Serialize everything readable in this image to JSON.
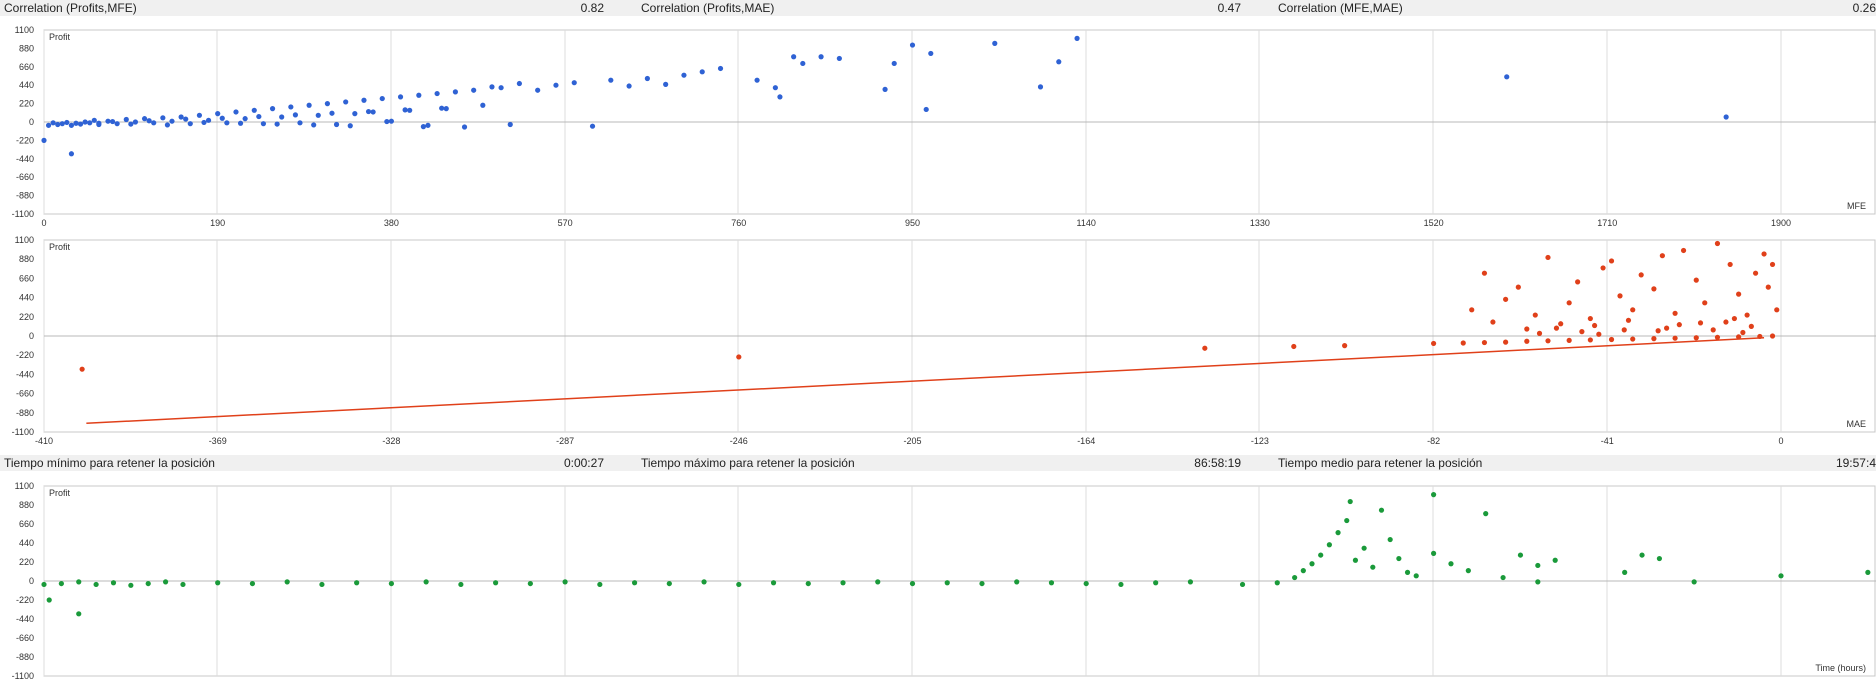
{
  "stats_top": [
    {
      "label": "Correlation (Profits,MFE)",
      "value": "0.82"
    },
    {
      "label": "Correlation (Profits,MAE)",
      "value": "0.47"
    },
    {
      "label": "Correlation (MFE,MAE)",
      "value": "0.26"
    }
  ],
  "stats_time": [
    {
      "label": "Tiempo mínimo para retener la posición",
      "value": "0:00:27"
    },
    {
      "label": "Tiempo máximo para retener la posición",
      "value": "86:58:19"
    },
    {
      "label": "Tiempo medio para retener la posición",
      "value": "19:57:4"
    }
  ],
  "chart_data": [
    {
      "type": "scatter",
      "xlabel": "MFE",
      "ylabel": "Profit",
      "xlim": [
        0,
        1900
      ],
      "ylim": [
        -1100,
        1100
      ],
      "x_ticks": [
        "0",
        "190",
        "380",
        "570",
        "760",
        "950",
        "1140",
        "1330",
        "1520",
        "1710",
        "1900"
      ],
      "y_ticks": [
        "1100",
        "880",
        "660",
        "440",
        "220",
        "0",
        "-220",
        "-440",
        "-660",
        "-880",
        "-1100"
      ],
      "grid": true,
      "color": "#2f62d4",
      "points": [
        [
          0,
          -220
        ],
        [
          30,
          -380
        ],
        [
          5,
          -40
        ],
        [
          10,
          -10
        ],
        [
          15,
          -30
        ],
        [
          20,
          -20
        ],
        [
          25,
          -5
        ],
        [
          30,
          -40
        ],
        [
          35,
          -15
        ],
        [
          40,
          -25
        ],
        [
          45,
          0
        ],
        [
          50,
          -10
        ],
        [
          55,
          20
        ],
        [
          60,
          -30
        ],
        [
          70,
          10
        ],
        [
          80,
          -20
        ],
        [
          90,
          30
        ],
        [
          100,
          0
        ],
        [
          110,
          40
        ],
        [
          120,
          -10
        ],
        [
          130,
          50
        ],
        [
          140,
          10
        ],
        [
          150,
          60
        ],
        [
          160,
          -20
        ],
        [
          170,
          80
        ],
        [
          180,
          20
        ],
        [
          190,
          100
        ],
        [
          200,
          -10
        ],
        [
          210,
          120
        ],
        [
          220,
          40
        ],
        [
          230,
          140
        ],
        [
          240,
          -20
        ],
        [
          250,
          160
        ],
        [
          260,
          60
        ],
        [
          270,
          180
        ],
        [
          280,
          -10
        ],
        [
          290,
          200
        ],
        [
          300,
          80
        ],
        [
          310,
          220
        ],
        [
          320,
          -30
        ],
        [
          330,
          240
        ],
        [
          340,
          100
        ],
        [
          350,
          260
        ],
        [
          360,
          120
        ],
        [
          370,
          280
        ],
        [
          380,
          10
        ],
        [
          390,
          300
        ],
        [
          400,
          140
        ],
        [
          410,
          320
        ],
        [
          420,
          -40
        ],
        [
          430,
          340
        ],
        [
          440,
          160
        ],
        [
          450,
          360
        ],
        [
          460,
          -60
        ],
        [
          470,
          380
        ],
        [
          480,
          200
        ],
        [
          490,
          420
        ],
        [
          500,
          410
        ],
        [
          510,
          -30
        ],
        [
          520,
          460
        ],
        [
          540,
          380
        ],
        [
          560,
          440
        ],
        [
          580,
          470
        ],
        [
          600,
          -50
        ],
        [
          620,
          500
        ],
        [
          640,
          430
        ],
        [
          660,
          520
        ],
        [
          680,
          450
        ],
        [
          700,
          560
        ],
        [
          720,
          600
        ],
        [
          740,
          640
        ],
        [
          780,
          500
        ],
        [
          800,
          410
        ],
        [
          805,
          300
        ],
        [
          820,
          780
        ],
        [
          830,
          700
        ],
        [
          850,
          780
        ],
        [
          870,
          760
        ],
        [
          920,
          390
        ],
        [
          930,
          700
        ],
        [
          950,
          920
        ],
        [
          965,
          150
        ],
        [
          970,
          820
        ],
        [
          1040,
          940
        ],
        [
          1090,
          420
        ],
        [
          1110,
          720
        ],
        [
          1130,
          1000
        ],
        [
          1600,
          540
        ],
        [
          1840,
          60
        ],
        [
          60,
          -15
        ],
        [
          75,
          5
        ],
        [
          95,
          -25
        ],
        [
          115,
          15
        ],
        [
          135,
          -35
        ],
        [
          155,
          35
        ],
        [
          175,
          -5
        ],
        [
          195,
          45
        ],
        [
          215,
          -15
        ],
        [
          235,
          65
        ],
        [
          255,
          -25
        ],
        [
          275,
          85
        ],
        [
          295,
          -35
        ],
        [
          315,
          105
        ],
        [
          335,
          -45
        ],
        [
          355,
          125
        ],
        [
          375,
          5
        ],
        [
          395,
          145
        ],
        [
          415,
          -55
        ],
        [
          435,
          165
        ]
      ]
    },
    {
      "type": "scatter",
      "xlabel": "MAE",
      "ylabel": "Profit",
      "xlim": [
        -410,
        0
      ],
      "ylim": [
        -1100,
        1100
      ],
      "x_ticks": [
        "-410",
        "-369",
        "-328",
        "-287",
        "-246",
        "-205",
        "-164",
        "-123",
        "-82",
        "-41",
        "0"
      ],
      "y_ticks": [
        "1100",
        "880",
        "660",
        "440",
        "220",
        "0",
        "-220",
        "-440",
        "-660",
        "-880",
        "-1100"
      ],
      "grid": true,
      "color": "#e0401a",
      "trendline": [
        [
          -400,
          -1000
        ],
        [
          -4,
          -20
        ]
      ],
      "points": [
        [
          -401,
          -380
        ],
        [
          -246,
          -240
        ],
        [
          -136,
          -140
        ],
        [
          -115,
          -120
        ],
        [
          -103,
          -110
        ],
        [
          -82,
          -85
        ],
        [
          -75,
          -80
        ],
        [
          -70,
          -75
        ],
        [
          -65,
          -70
        ],
        [
          -60,
          -60
        ],
        [
          -55,
          -55
        ],
        [
          -50,
          -50
        ],
        [
          -45,
          -45
        ],
        [
          -40,
          -40
        ],
        [
          -35,
          -35
        ],
        [
          -30,
          -30
        ],
        [
          -25,
          -25
        ],
        [
          -20,
          -20
        ],
        [
          -15,
          -15
        ],
        [
          -10,
          -10
        ],
        [
          -5,
          -5
        ],
        [
          -2,
          0
        ],
        [
          -73,
          300
        ],
        [
          -70,
          720
        ],
        [
          -68,
          160
        ],
        [
          -65,
          420
        ],
        [
          -62,
          560
        ],
        [
          -58,
          240
        ],
        [
          -55,
          900
        ],
        [
          -52,
          140
        ],
        [
          -50,
          380
        ],
        [
          -48,
          620
        ],
        [
          -45,
          200
        ],
        [
          -42,
          780
        ],
        [
          -40,
          860
        ],
        [
          -38,
          460
        ],
        [
          -35,
          300
        ],
        [
          -33,
          700
        ],
        [
          -30,
          540
        ],
        [
          -28,
          920
        ],
        [
          -25,
          260
        ],
        [
          -23,
          980
        ],
        [
          -20,
          640
        ],
        [
          -18,
          380
        ],
        [
          -15,
          1060
        ],
        [
          -12,
          820
        ],
        [
          -10,
          480
        ],
        [
          -8,
          240
        ],
        [
          -6,
          720
        ],
        [
          -4,
          940
        ],
        [
          -3,
          560
        ],
        [
          -2,
          820
        ],
        [
          -1,
          300
        ],
        [
          -44,
          120
        ],
        [
          -36,
          180
        ],
        [
          -27,
          90
        ],
        [
          -19,
          150
        ],
        [
          -11,
          200
        ],
        [
          -7,
          110
        ],
        [
          -29,
          60
        ],
        [
          -24,
          130
        ],
        [
          -16,
          70
        ],
        [
          -13,
          160
        ],
        [
          -9,
          40
        ],
        [
          -60,
          80
        ],
        [
          -57,
          30
        ],
        [
          -53,
          90
        ],
        [
          -47,
          50
        ],
        [
          -43,
          20
        ],
        [
          -37,
          70
        ]
      ]
    },
    {
      "type": "scatter",
      "xlabel": "Time (hours)",
      "ylabel": "Profit",
      "xlim": [
        0,
        100
      ],
      "ylim": [
        -1100,
        1100
      ],
      "y_ticks": [
        "1100",
        "880",
        "660",
        "440",
        "220",
        "0",
        "-220",
        "-440",
        "-660",
        "-880",
        "-1100"
      ],
      "grid": true,
      "color": "#1a9a3a",
      "points": [
        [
          0,
          -40
        ],
        [
          0.3,
          -220
        ],
        [
          1,
          -30
        ],
        [
          2,
          -380
        ],
        [
          2,
          -10
        ],
        [
          3,
          -40
        ],
        [
          4,
          -20
        ],
        [
          5,
          -50
        ],
        [
          6,
          -30
        ],
        [
          7,
          -10
        ],
        [
          8,
          -40
        ],
        [
          10,
          -20
        ],
        [
          12,
          -30
        ],
        [
          14,
          -10
        ],
        [
          16,
          -40
        ],
        [
          18,
          -20
        ],
        [
          20,
          -30
        ],
        [
          22,
          -10
        ],
        [
          24,
          -40
        ],
        [
          26,
          -20
        ],
        [
          28,
          -30
        ],
        [
          30,
          -10
        ],
        [
          32,
          -40
        ],
        [
          34,
          -20
        ],
        [
          36,
          -30
        ],
        [
          38,
          -10
        ],
        [
          40,
          -40
        ],
        [
          42,
          -20
        ],
        [
          44,
          -30
        ],
        [
          46,
          -20
        ],
        [
          48,
          -10
        ],
        [
          50,
          -30
        ],
        [
          52,
          -20
        ],
        [
          54,
          -30
        ],
        [
          56,
          -10
        ],
        [
          58,
          -20
        ],
        [
          60,
          -30
        ],
        [
          62,
          -40
        ],
        [
          64,
          -20
        ],
        [
          66,
          -10
        ],
        [
          69,
          -40
        ],
        [
          71,
          -20
        ],
        [
          72,
          40
        ],
        [
          72.5,
          120
        ],
        [
          73,
          200
        ],
        [
          73.5,
          300
        ],
        [
          74,
          420
        ],
        [
          74.5,
          560
        ],
        [
          75,
          700
        ],
        [
          75.2,
          920
        ],
        [
          75.5,
          240
        ],
        [
          76,
          380
        ],
        [
          76.5,
          160
        ],
        [
          77,
          820
        ],
        [
          77.5,
          480
        ],
        [
          78,
          260
        ],
        [
          78.5,
          100
        ],
        [
          79,
          60
        ],
        [
          80,
          1000
        ],
        [
          80,
          320
        ],
        [
          81,
          200
        ],
        [
          82,
          120
        ],
        [
          83,
          780
        ],
        [
          84,
          40
        ],
        [
          85,
          300
        ],
        [
          86,
          -10
        ],
        [
          86,
          180
        ],
        [
          87,
          240
        ],
        [
          91,
          100
        ],
        [
          92,
          300
        ],
        [
          93,
          260
        ],
        [
          95,
          -10
        ],
        [
          105,
          100
        ],
        [
          108,
          520
        ],
        [
          109,
          360
        ],
        [
          110,
          0
        ],
        [
          117,
          140
        ],
        [
          118,
          200
        ],
        [
          130,
          20
        ],
        [
          100,
          60
        ]
      ]
    }
  ]
}
